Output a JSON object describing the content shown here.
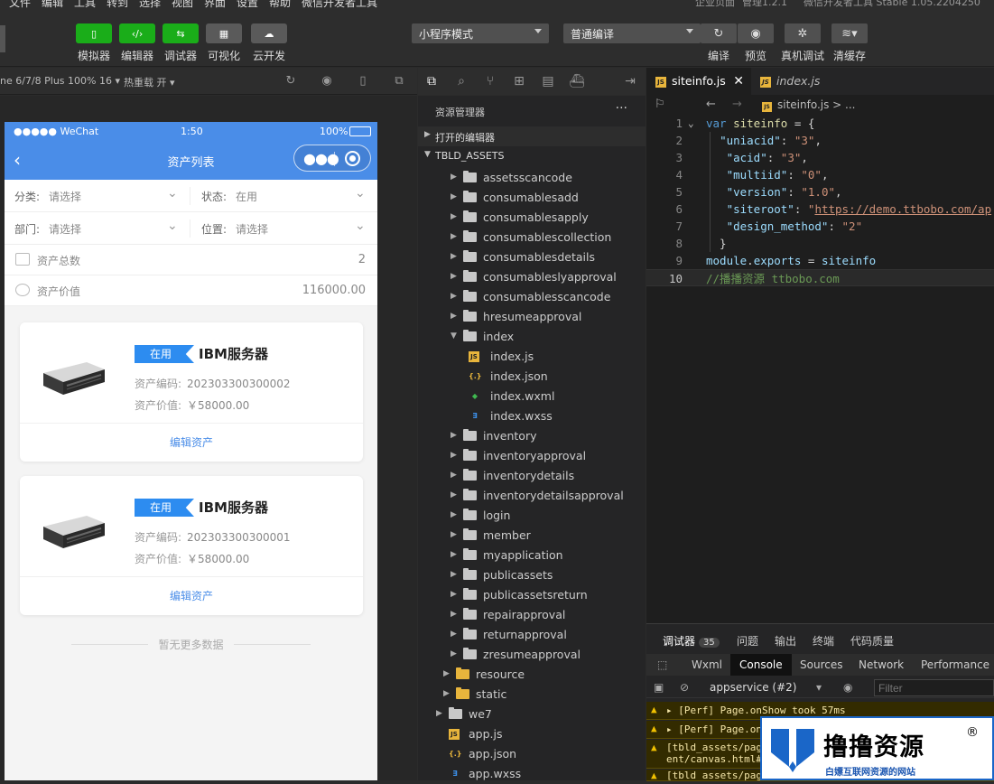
{
  "menubar": {
    "items": [
      "文件",
      "编辑",
      "工具",
      "转到",
      "选择",
      "视图",
      "界面",
      "设置",
      "帮助",
      "微信开发者工具"
    ],
    "right": [
      "企业页面",
      "管理1.2.1",
      "微信开发者工具 Stable 1.05.2204250"
    ]
  },
  "toolbar": {
    "buttons": [
      {
        "label": "模拟器",
        "icon": "phone-icon"
      },
      {
        "label": "编辑器",
        "icon": "code-icon"
      },
      {
        "label": "调试器",
        "icon": "debug-icon"
      },
      {
        "label": "可视化",
        "icon": "layout-icon"
      },
      {
        "label": "云开发",
        "icon": "cloud-icon"
      }
    ],
    "mode_select": "小程序模式",
    "compile_select": "普通编译",
    "right_buttons": [
      {
        "label": "编译",
        "icon": "refresh-icon"
      },
      {
        "label": "预览",
        "icon": "eye-icon"
      },
      {
        "label": "真机调试",
        "icon": "bug-icon"
      },
      {
        "label": "清缓存",
        "icon": "layers-icon"
      }
    ]
  },
  "simbar": {
    "device": "ne 6/7/8 Plus 100% 16 ▾",
    "hotreload": "热重载 开 ▾"
  },
  "phone": {
    "status": {
      "carrier": "●●●●● WeChat",
      "time": "1:50",
      "battery": "100%"
    },
    "nav_title": "资产列表",
    "filters": [
      {
        "label": "分类:",
        "value": "请选择",
        "label2": "状态:",
        "value2": "在用"
      },
      {
        "label": "部门:",
        "value": "请选择",
        "label2": "位置:",
        "value2": "请选择"
      }
    ],
    "stats": [
      {
        "label": "资产总数",
        "value": "2"
      },
      {
        "label": "资产价值",
        "value": "116000.00"
      }
    ],
    "cards": [
      {
        "tag": "在用",
        "name": "IBM服务器",
        "code_label": "资产编码:",
        "code": "202303300300002",
        "value_label": "资产价值:",
        "value": "￥58000.00",
        "edit": "编辑资产"
      },
      {
        "tag": "在用",
        "name": "IBM服务器",
        "code_label": "资产编码:",
        "code": "202303300300001",
        "value_label": "资产价值:",
        "value": "￥58000.00",
        "edit": "编辑资产"
      }
    ],
    "no_more": "暂无更多数据"
  },
  "explorer": {
    "title": "资源管理器",
    "more": "···",
    "sections": [
      "打开的编辑器",
      "TBLD_ASSETS"
    ],
    "tree": [
      {
        "name": "assetsscancode",
        "type": "folder",
        "depth": 1,
        "open": false
      },
      {
        "name": "consumablesadd",
        "type": "folder",
        "depth": 1,
        "open": false
      },
      {
        "name": "consumablesapply",
        "type": "folder",
        "depth": 1,
        "open": false
      },
      {
        "name": "consumablescollection",
        "type": "folder",
        "depth": 1,
        "open": false
      },
      {
        "name": "consumablesdetails",
        "type": "folder",
        "depth": 1,
        "open": false
      },
      {
        "name": "consumableslyapproval",
        "type": "folder",
        "depth": 1,
        "open": false
      },
      {
        "name": "consumablesscancode",
        "type": "folder",
        "depth": 1,
        "open": false
      },
      {
        "name": "hresumeapproval",
        "type": "folder",
        "depth": 1,
        "open": false
      },
      {
        "name": "index",
        "type": "folder",
        "depth": 1,
        "open": true
      },
      {
        "name": "index.js",
        "type": "js",
        "depth": 2
      },
      {
        "name": "index.json",
        "type": "json",
        "depth": 2
      },
      {
        "name": "index.wxml",
        "type": "wxml",
        "depth": 2
      },
      {
        "name": "index.wxss",
        "type": "wxss",
        "depth": 2
      },
      {
        "name": "inventory",
        "type": "folder",
        "depth": 1,
        "open": false
      },
      {
        "name": "inventoryapproval",
        "type": "folder",
        "depth": 1,
        "open": false
      },
      {
        "name": "inventorydetails",
        "type": "folder",
        "depth": 1,
        "open": false
      },
      {
        "name": "inventorydetailsapproval",
        "type": "folder",
        "depth": 1,
        "open": false
      },
      {
        "name": "login",
        "type": "folder",
        "depth": 1,
        "open": false
      },
      {
        "name": "member",
        "type": "folder",
        "depth": 1,
        "open": false
      },
      {
        "name": "myapplication",
        "type": "folder",
        "depth": 1,
        "open": false
      },
      {
        "name": "publicassets",
        "type": "folder",
        "depth": 1,
        "open": false
      },
      {
        "name": "publicassetsreturn",
        "type": "folder",
        "depth": 1,
        "open": false
      },
      {
        "name": "repairapproval",
        "type": "folder",
        "depth": 1,
        "open": false
      },
      {
        "name": "returnapproval",
        "type": "folder",
        "depth": 1,
        "open": false
      },
      {
        "name": "zresumeapproval",
        "type": "folder",
        "depth": 1,
        "open": false
      },
      {
        "name": "resource",
        "type": "folder-y",
        "depth": 0,
        "open": false
      },
      {
        "name": "static",
        "type": "folder-y",
        "depth": 0,
        "open": false
      },
      {
        "name": "we7",
        "type": "folder",
        "depth": -1,
        "open": false
      },
      {
        "name": "app.js",
        "type": "js",
        "depth": -1
      },
      {
        "name": "app.json",
        "type": "json",
        "depth": -1
      },
      {
        "name": "app.wxss",
        "type": "wxss",
        "depth": -1
      }
    ]
  },
  "editor": {
    "tabs": [
      {
        "label": "siteinfo.js",
        "active": true
      },
      {
        "label": "index.js",
        "active": false
      }
    ],
    "breadcrumb": "siteinfo.js > ...",
    "lines": [
      {
        "n": "1",
        "tokens": [
          [
            "kw",
            "var "
          ],
          [
            "vr",
            "siteinfo"
          ],
          [
            "pl",
            " = {"
          ]
        ]
      },
      {
        "n": "2",
        "tokens": [
          [
            "pl",
            "  "
          ],
          [
            "key",
            "\"uniacid\""
          ],
          [
            "pl",
            ": "
          ],
          [
            "str",
            "\"3\""
          ],
          [
            "pl",
            ","
          ]
        ]
      },
      {
        "n": "3",
        "tokens": [
          [
            "pl",
            "   "
          ],
          [
            "key",
            "\"acid\""
          ],
          [
            "pl",
            ": "
          ],
          [
            "str",
            "\"3\""
          ],
          [
            "pl",
            ","
          ]
        ]
      },
      {
        "n": "4",
        "tokens": [
          [
            "pl",
            "   "
          ],
          [
            "key",
            "\"multiid\""
          ],
          [
            "pl",
            ": "
          ],
          [
            "str",
            "\"0\""
          ],
          [
            "pl",
            ","
          ]
        ]
      },
      {
        "n": "5",
        "tokens": [
          [
            "pl",
            "   "
          ],
          [
            "key",
            "\"version\""
          ],
          [
            "pl",
            ": "
          ],
          [
            "str",
            "\"1.0\""
          ],
          [
            "pl",
            ","
          ]
        ]
      },
      {
        "n": "6",
        "tokens": [
          [
            "pl",
            "   "
          ],
          [
            "key",
            "\"siteroot\""
          ],
          [
            "pl",
            ": "
          ],
          [
            "str",
            "\""
          ],
          [
            "url",
            "https://demo.ttbobo.com/ap"
          ]
        ]
      },
      {
        "n": "7",
        "tokens": [
          [
            "pl",
            "   "
          ],
          [
            "key",
            "\"design_method\""
          ],
          [
            "pl",
            ": "
          ],
          [
            "str",
            "\"2\""
          ]
        ]
      },
      {
        "n": "8",
        "tokens": [
          [
            "pl",
            "  }"
          ]
        ]
      },
      {
        "n": "9",
        "tokens": [
          [
            "key",
            "module"
          ],
          [
            "pl",
            "."
          ],
          [
            "key",
            "exports"
          ],
          [
            "pl",
            " = "
          ],
          [
            "key",
            "siteinfo"
          ]
        ]
      },
      {
        "n": "10",
        "tokens": [
          [
            "cm",
            "//播播资源 ttbobo.com"
          ]
        ]
      }
    ]
  },
  "debug": {
    "tabs": [
      "调试器",
      "问题",
      "输出",
      "终端",
      "代码质量"
    ],
    "badge": "35",
    "panels": [
      "Wxml",
      "Console",
      "Sources",
      "Network",
      "Performance"
    ],
    "active_panel": "Console",
    "context": "appservice (#2)",
    "filter_placeholder": "Filter",
    "logs": [
      "▸ [Perf] Page.onShow took 57ms",
      "▸ [Perf] Page.on",
      "[tbld_assets/pag\nent/canvas.html#",
      "[tbld_assets/pag"
    ]
  },
  "watermark": {
    "big": "撸撸资源",
    "small": "白嫖互联网资源的网站",
    "reg": "®"
  }
}
